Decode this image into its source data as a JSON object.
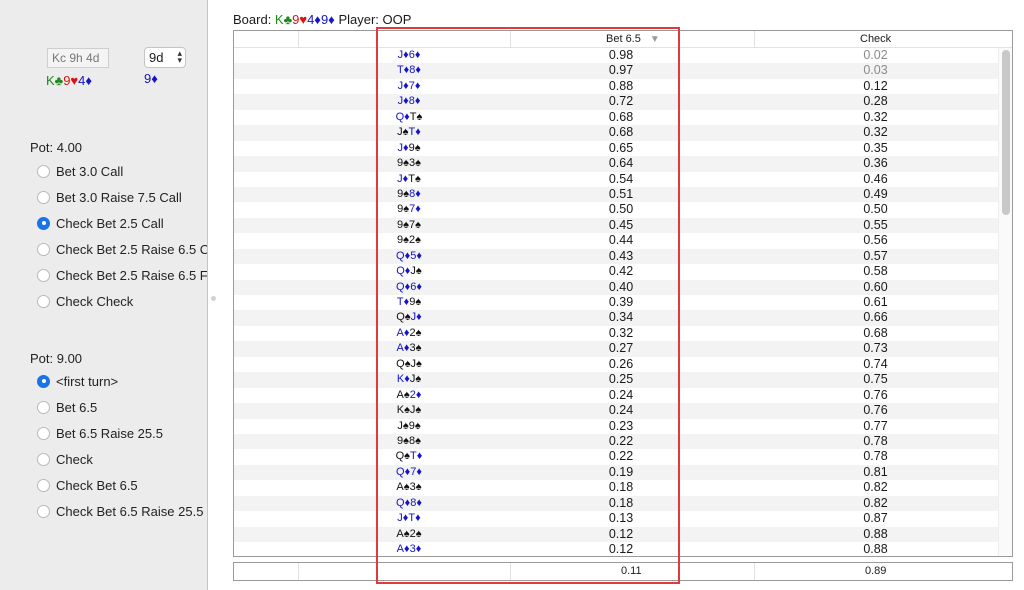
{
  "left": {
    "board_input": "Kc 9h 4d",
    "card_select": "9d",
    "board_cards": [
      {
        "t": "K♣",
        "c": "green"
      },
      {
        "t": "9♥",
        "c": "red"
      },
      {
        "t": "4♦",
        "c": "blue"
      }
    ],
    "turn_card": {
      "t": "9♦",
      "c": "blue"
    },
    "pot1": {
      "label": "Pot: 4.00",
      "options": [
        {
          "label": "Bet 3.0 Call",
          "selected": false
        },
        {
          "label": "Bet 3.0 Raise 7.5 Call",
          "selected": false
        },
        {
          "label": "Check Bet 2.5 Call",
          "selected": true
        },
        {
          "label": "Check Bet 2.5 Raise 6.5 C",
          "selected": false
        },
        {
          "label": "Check Bet 2.5 Raise 6.5 F",
          "selected": false
        },
        {
          "label": "Check Check",
          "selected": false
        }
      ]
    },
    "pot2": {
      "label": "Pot: 9.00",
      "options": [
        {
          "label": "<first turn>",
          "selected": true
        },
        {
          "label": "Bet 6.5",
          "selected": false
        },
        {
          "label": "Bet 6.5 Raise 25.5",
          "selected": false
        },
        {
          "label": "Check",
          "selected": false
        },
        {
          "label": "Check Bet 6.5",
          "selected": false
        },
        {
          "label": "Check Bet 6.5 Raise 25.5",
          "selected": false
        }
      ]
    }
  },
  "header": {
    "board_label": "Board: ",
    "board_cards": [
      {
        "t": "K♣",
        "c": "green"
      },
      {
        "t": "9♥",
        "c": "red"
      },
      {
        "t": "4♦",
        "c": "blue"
      },
      {
        "t": "9♦",
        "c": "blue"
      }
    ],
    "player": " Player: OOP"
  },
  "table": {
    "columns": {
      "bet": "Bet 6.5",
      "check": "Check"
    },
    "sort_icon": "sort-descending-icon",
    "rows": [
      {
        "hand": [
          [
            "J",
            "blue"
          ],
          [
            "♦",
            "blue"
          ],
          [
            "6",
            "blue"
          ],
          [
            "♦",
            "blue"
          ]
        ],
        "bet": "0.98",
        "check": "0.02",
        "muted": true
      },
      {
        "hand": [
          [
            "T",
            "blue"
          ],
          [
            "♦",
            "blue"
          ],
          [
            "8",
            "blue"
          ],
          [
            "♦",
            "blue"
          ]
        ],
        "bet": "0.97",
        "check": "0.03",
        "muted": true
      },
      {
        "hand": [
          [
            "J",
            "blue"
          ],
          [
            "♦",
            "blue"
          ],
          [
            "7",
            "blue"
          ],
          [
            "♦",
            "blue"
          ]
        ],
        "bet": "0.88",
        "check": "0.12"
      },
      {
        "hand": [
          [
            "J",
            "blue"
          ],
          [
            "♦",
            "blue"
          ],
          [
            "8",
            "blue"
          ],
          [
            "♦",
            "blue"
          ]
        ],
        "bet": "0.72",
        "check": "0.28"
      },
      {
        "hand": [
          [
            "Q",
            "blue"
          ],
          [
            "♦",
            "blue"
          ],
          [
            "T",
            "black"
          ],
          [
            "♠",
            "black"
          ]
        ],
        "bet": "0.68",
        "check": "0.32"
      },
      {
        "hand": [
          [
            "J",
            "black"
          ],
          [
            "♠",
            "black"
          ],
          [
            "T",
            "blue"
          ],
          [
            "♦",
            "blue"
          ]
        ],
        "bet": "0.68",
        "check": "0.32"
      },
      {
        "hand": [
          [
            "J",
            "blue"
          ],
          [
            "♦",
            "blue"
          ],
          [
            "9",
            "black"
          ],
          [
            "♠",
            "black"
          ]
        ],
        "bet": "0.65",
        "check": "0.35"
      },
      {
        "hand": [
          [
            "9",
            "black"
          ],
          [
            "♠",
            "black"
          ],
          [
            "3",
            "black"
          ],
          [
            "♠",
            "black"
          ]
        ],
        "bet": "0.64",
        "check": "0.36"
      },
      {
        "hand": [
          [
            "J",
            "blue"
          ],
          [
            "♦",
            "blue"
          ],
          [
            "T",
            "black"
          ],
          [
            "♠",
            "black"
          ]
        ],
        "bet": "0.54",
        "check": "0.46"
      },
      {
        "hand": [
          [
            "9",
            "black"
          ],
          [
            "♠",
            "black"
          ],
          [
            "8",
            "blue"
          ],
          [
            "♦",
            "blue"
          ]
        ],
        "bet": "0.51",
        "check": "0.49"
      },
      {
        "hand": [
          [
            "9",
            "black"
          ],
          [
            "♠",
            "black"
          ],
          [
            "7",
            "blue"
          ],
          [
            "♦",
            "blue"
          ]
        ],
        "bet": "0.50",
        "check": "0.50"
      },
      {
        "hand": [
          [
            "9",
            "black"
          ],
          [
            "♠",
            "black"
          ],
          [
            "7",
            "black"
          ],
          [
            "♠",
            "black"
          ]
        ],
        "bet": "0.45",
        "check": "0.55"
      },
      {
        "hand": [
          [
            "9",
            "black"
          ],
          [
            "♠",
            "black"
          ],
          [
            "2",
            "black"
          ],
          [
            "♠",
            "black"
          ]
        ],
        "bet": "0.44",
        "check": "0.56"
      },
      {
        "hand": [
          [
            "Q",
            "blue"
          ],
          [
            "♦",
            "blue"
          ],
          [
            "5",
            "blue"
          ],
          [
            "♦",
            "blue"
          ]
        ],
        "bet": "0.43",
        "check": "0.57"
      },
      {
        "hand": [
          [
            "Q",
            "blue"
          ],
          [
            "♦",
            "blue"
          ],
          [
            "J",
            "black"
          ],
          [
            "♠",
            "black"
          ]
        ],
        "bet": "0.42",
        "check": "0.58"
      },
      {
        "hand": [
          [
            "Q",
            "blue"
          ],
          [
            "♦",
            "blue"
          ],
          [
            "6",
            "blue"
          ],
          [
            "♦",
            "blue"
          ]
        ],
        "bet": "0.40",
        "check": "0.60"
      },
      {
        "hand": [
          [
            "T",
            "blue"
          ],
          [
            "♦",
            "blue"
          ],
          [
            "9",
            "black"
          ],
          [
            "♠",
            "black"
          ]
        ],
        "bet": "0.39",
        "check": "0.61"
      },
      {
        "hand": [
          [
            "Q",
            "black"
          ],
          [
            "♠",
            "black"
          ],
          [
            "J",
            "blue"
          ],
          [
            "♦",
            "blue"
          ]
        ],
        "bet": "0.34",
        "check": "0.66"
      },
      {
        "hand": [
          [
            "A",
            "blue"
          ],
          [
            "♦",
            "blue"
          ],
          [
            "2",
            "black"
          ],
          [
            "♠",
            "black"
          ]
        ],
        "bet": "0.32",
        "check": "0.68"
      },
      {
        "hand": [
          [
            "A",
            "blue"
          ],
          [
            "♦",
            "blue"
          ],
          [
            "3",
            "black"
          ],
          [
            "♠",
            "black"
          ]
        ],
        "bet": "0.27",
        "check": "0.73"
      },
      {
        "hand": [
          [
            "Q",
            "black"
          ],
          [
            "♠",
            "black"
          ],
          [
            "J",
            "black"
          ],
          [
            "♠",
            "black"
          ]
        ],
        "bet": "0.26",
        "check": "0.74"
      },
      {
        "hand": [
          [
            "K",
            "blue"
          ],
          [
            "♦",
            "blue"
          ],
          [
            "J",
            "black"
          ],
          [
            "♠",
            "black"
          ]
        ],
        "bet": "0.25",
        "check": "0.75"
      },
      {
        "hand": [
          [
            "A",
            "black"
          ],
          [
            "♠",
            "black"
          ],
          [
            "2",
            "blue"
          ],
          [
            "♦",
            "blue"
          ]
        ],
        "bet": "0.24",
        "check": "0.76"
      },
      {
        "hand": [
          [
            "K",
            "black"
          ],
          [
            "♠",
            "black"
          ],
          [
            "J",
            "black"
          ],
          [
            "♠",
            "black"
          ]
        ],
        "bet": "0.24",
        "check": "0.76"
      },
      {
        "hand": [
          [
            "J",
            "black"
          ],
          [
            "♠",
            "black"
          ],
          [
            "9",
            "black"
          ],
          [
            "♠",
            "black"
          ]
        ],
        "bet": "0.23",
        "check": "0.77"
      },
      {
        "hand": [
          [
            "9",
            "black"
          ],
          [
            "♠",
            "black"
          ],
          [
            "8",
            "black"
          ],
          [
            "♠",
            "black"
          ]
        ],
        "bet": "0.22",
        "check": "0.78"
      },
      {
        "hand": [
          [
            "Q",
            "black"
          ],
          [
            "♠",
            "black"
          ],
          [
            "T",
            "blue"
          ],
          [
            "♦",
            "blue"
          ]
        ],
        "bet": "0.22",
        "check": "0.78"
      },
      {
        "hand": [
          [
            "Q",
            "blue"
          ],
          [
            "♦",
            "blue"
          ],
          [
            "7",
            "blue"
          ],
          [
            "♦",
            "blue"
          ]
        ],
        "bet": "0.19",
        "check": "0.81"
      },
      {
        "hand": [
          [
            "A",
            "black"
          ],
          [
            "♠",
            "black"
          ],
          [
            "3",
            "black"
          ],
          [
            "♠",
            "black"
          ]
        ],
        "bet": "0.18",
        "check": "0.82"
      },
      {
        "hand": [
          [
            "Q",
            "blue"
          ],
          [
            "♦",
            "blue"
          ],
          [
            "8",
            "blue"
          ],
          [
            "♦",
            "blue"
          ]
        ],
        "bet": "0.18",
        "check": "0.82"
      },
      {
        "hand": [
          [
            "J",
            "blue"
          ],
          [
            "♦",
            "blue"
          ],
          [
            "T",
            "blue"
          ],
          [
            "♦",
            "blue"
          ]
        ],
        "bet": "0.13",
        "check": "0.87"
      },
      {
        "hand": [
          [
            "A",
            "black"
          ],
          [
            "♠",
            "black"
          ],
          [
            "2",
            "black"
          ],
          [
            "♠",
            "black"
          ]
        ],
        "bet": "0.12",
        "check": "0.88"
      },
      {
        "hand": [
          [
            "A",
            "blue"
          ],
          [
            "♦",
            "blue"
          ],
          [
            "3",
            "blue"
          ],
          [
            "♦",
            "blue"
          ]
        ],
        "bet": "0.12",
        "check": "0.88"
      }
    ],
    "footer": {
      "bet": "0.11",
      "check": "0.89"
    }
  },
  "colors": {
    "green": "#1a8a1a",
    "red": "#e01010",
    "blue": "#1414c8",
    "black": "#111111",
    "highlight": "#e23a3a",
    "radio_on": "#1a73e8"
  }
}
